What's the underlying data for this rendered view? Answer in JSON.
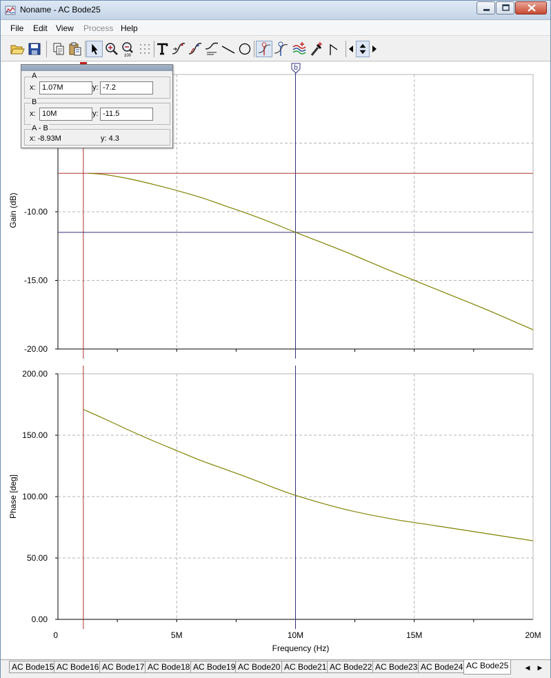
{
  "window": {
    "title": "Noname - AC Bode25"
  },
  "menu": [
    {
      "label": "File",
      "disabled": false
    },
    {
      "label": "Edit",
      "disabled": false
    },
    {
      "label": "View",
      "disabled": false
    },
    {
      "label": "Process",
      "disabled": true
    },
    {
      "label": "Help",
      "disabled": false
    }
  ],
  "toolbar": {
    "items": [
      "open-icon",
      "save-icon",
      "copy-icon",
      "paste-icon",
      "select-arrow-icon",
      "zoom-in-icon",
      "zoom-out-icon",
      "grid-icon",
      "text-icon",
      "curve-tool-1-icon",
      "curve-tool-2-icon",
      "curve-tool-3-icon",
      "line-icon",
      "ellipse-icon",
      "cursor-a-icon",
      "cursor-b-icon",
      "curve-colors-icon",
      "marker-icon",
      "tangent-icon",
      "arrow-left-icon",
      "arrow-updown-icon",
      "arrow-right-icon"
    ],
    "zoom_out_badge": "100"
  },
  "cursor_panel": {
    "a": {
      "title": "A",
      "x_label": "x:",
      "x": "1.07M",
      "y_label": "y:",
      "y": "-7.2"
    },
    "b": {
      "title": "B",
      "x_label": "x:",
      "x": "10M",
      "y_label": "y:",
      "y": "-11.5"
    },
    "diff": {
      "title": "A - B",
      "x_text": "x:  -8.93M",
      "y_text": "y: 4.3"
    },
    "b_marker_label": "b"
  },
  "chart_data": [
    {
      "type": "line",
      "title": "",
      "xlabel": "",
      "ylabel": "Gain (dB)",
      "xlim": [
        0,
        20000000
      ],
      "ylim": [
        -20,
        0
      ],
      "y_tick_labels": [
        "-10.00",
        "-15.00",
        "-20.00"
      ],
      "grid": true,
      "x": [
        1300000,
        2000000,
        3000000,
        4000000,
        5000000,
        6000000,
        7000000,
        8000000,
        9000000,
        10000000,
        12000000,
        14000000,
        16000000,
        18000000,
        20000000
      ],
      "series": [
        {
          "values": [
            -7.2,
            -7.3,
            -7.6,
            -8.0,
            -8.45,
            -8.95,
            -9.55,
            -10.15,
            -10.8,
            -11.5,
            -12.85,
            -14.3,
            -15.7,
            -17.1,
            -18.6
          ]
        }
      ],
      "cursors": {
        "a_x": 1070000,
        "b_x": 10000000,
        "a_y": -7.2,
        "b_y": -11.5
      }
    },
    {
      "type": "line",
      "title": "",
      "xlabel": "Frequency (Hz)",
      "ylabel": "Phase [deg]",
      "xlim": [
        0,
        20000000
      ],
      "ylim": [
        0,
        200
      ],
      "y_tick_labels": [
        "200.00",
        "150.00",
        "100.00",
        "50.00",
        "0.00"
      ],
      "x_tick_labels": [
        "0",
        "5M",
        "10M",
        "15M",
        "20M"
      ],
      "grid": true,
      "x": [
        1070000,
        2000000,
        3000000,
        4000000,
        5000000,
        6000000,
        7000000,
        8000000,
        9000000,
        10000000,
        12000000,
        14000000,
        16000000,
        18000000,
        20000000
      ],
      "series": [
        {
          "values": [
            171,
            163,
            154,
            145.5,
            137.5,
            129.5,
            122.5,
            115.5,
            108,
            101,
            90,
            82,
            76,
            70,
            64
          ]
        }
      ],
      "cursors": {
        "a_x": 1070000,
        "b_x": 10000000
      }
    }
  ],
  "tabs": [
    {
      "label": "AC Bode15",
      "active": false
    },
    {
      "label": "AC Bode16",
      "active": false
    },
    {
      "label": "AC Bode17",
      "active": false
    },
    {
      "label": "AC Bode18",
      "active": false
    },
    {
      "label": "AC Bode19",
      "active": false
    },
    {
      "label": "AC Bode20",
      "active": false
    },
    {
      "label": "AC Bode21",
      "active": false
    },
    {
      "label": "AC Bode22",
      "active": false
    },
    {
      "label": "AC Bode23",
      "active": false
    },
    {
      "label": "AC Bode24",
      "active": false
    },
    {
      "label": "AC Bode25",
      "active": true
    }
  ],
  "colors": {
    "curve": "#808000",
    "cursor_a": "#b03030",
    "cursor_b": "#303080",
    "grid": "#b4b4b4"
  }
}
